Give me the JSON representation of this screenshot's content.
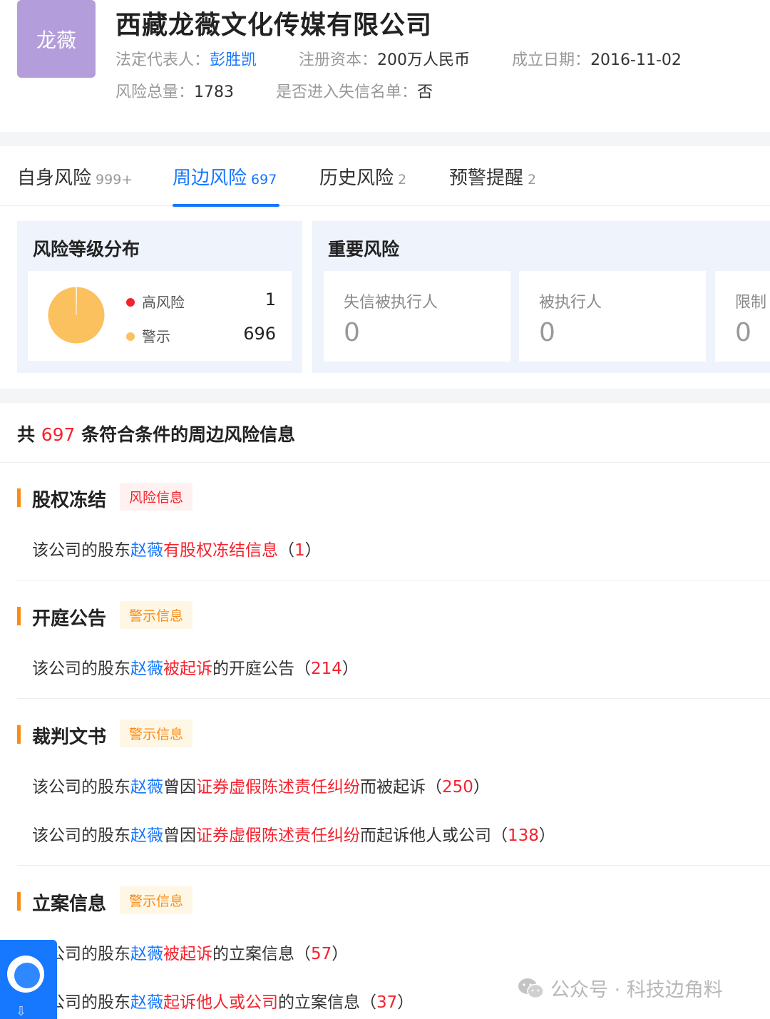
{
  "company": {
    "logo_text": "龙薇",
    "name": "西藏龙薇文化传媒有限公司",
    "legal_rep_label": "法定代表人：",
    "legal_rep": "彭胜凯",
    "capital_label": "注册资本：",
    "capital": "200万人民币",
    "founded_label": "成立日期：",
    "founded": "2016-11-02",
    "risk_total_label": "风险总量：",
    "risk_total": "1783",
    "dishonest_label": "是否进入失信名单：",
    "dishonest": "否"
  },
  "tabs": [
    {
      "label": "自身风险",
      "count": "999+"
    },
    {
      "label": "周边风险",
      "count": "697"
    },
    {
      "label": "历史风险",
      "count": "2"
    },
    {
      "label": "预警提醒",
      "count": "2"
    }
  ],
  "risk_level": {
    "title": "风险等级分布",
    "items": [
      {
        "label": "高风险",
        "value": "1",
        "color": "#f5222d"
      },
      {
        "label": "警示",
        "value": "696",
        "color": "#fbc15e"
      }
    ],
    "chart_data": {
      "type": "pie",
      "categories": [
        "高风险",
        "警示"
      ],
      "values": [
        1,
        696
      ]
    }
  },
  "important_risk": {
    "title": "重要风险",
    "cards": [
      {
        "label": "失信被执行人",
        "value": "0"
      },
      {
        "label": "被执行人",
        "value": "0"
      },
      {
        "label": "限制",
        "value": "0"
      }
    ]
  },
  "summary": {
    "prefix": "共 ",
    "count": "697",
    "suffix": " 条符合条件的周边风险信息"
  },
  "sections": [
    {
      "title": "股权冻结",
      "tag": "风险信息",
      "lines": [
        {
          "pre": "该公司的股东",
          "person": "赵薇",
          "mid": "",
          "link": "有股权冻结信息",
          "post": "",
          "count": "1"
        }
      ]
    },
    {
      "title": "开庭公告",
      "tag": "警示信息",
      "lines": [
        {
          "pre": "该公司的股东",
          "person": "赵薇",
          "mid": "",
          "link": "被起诉",
          "post": "的开庭公告",
          "count": "214"
        }
      ]
    },
    {
      "title": "裁判文书",
      "tag": "警示信息",
      "lines": [
        {
          "pre": "该公司的股东",
          "person": "赵薇",
          "mid": "曾因",
          "link": "证券虚假陈述责任纠纷",
          "post": "而被起诉",
          "count": "250"
        },
        {
          "pre": "该公司的股东",
          "person": "赵薇",
          "mid": "曾因",
          "link": "证券虚假陈述责任纠纷",
          "post": "而起诉他人或公司",
          "count": "138"
        }
      ]
    },
    {
      "title": "立案信息",
      "tag": "警示信息",
      "lines": [
        {
          "pre": "该公司的股东",
          "person": "赵薇",
          "mid": "",
          "link": "被起诉",
          "post": "的立案信息",
          "count": "57"
        },
        {
          "pre": "该公司的股东",
          "person": "赵薇",
          "mid": "",
          "link": "起诉他人或公司",
          "post": "的立案信息",
          "count": "37"
        }
      ]
    }
  ],
  "watermark": "公众号 · 科技边角料"
}
